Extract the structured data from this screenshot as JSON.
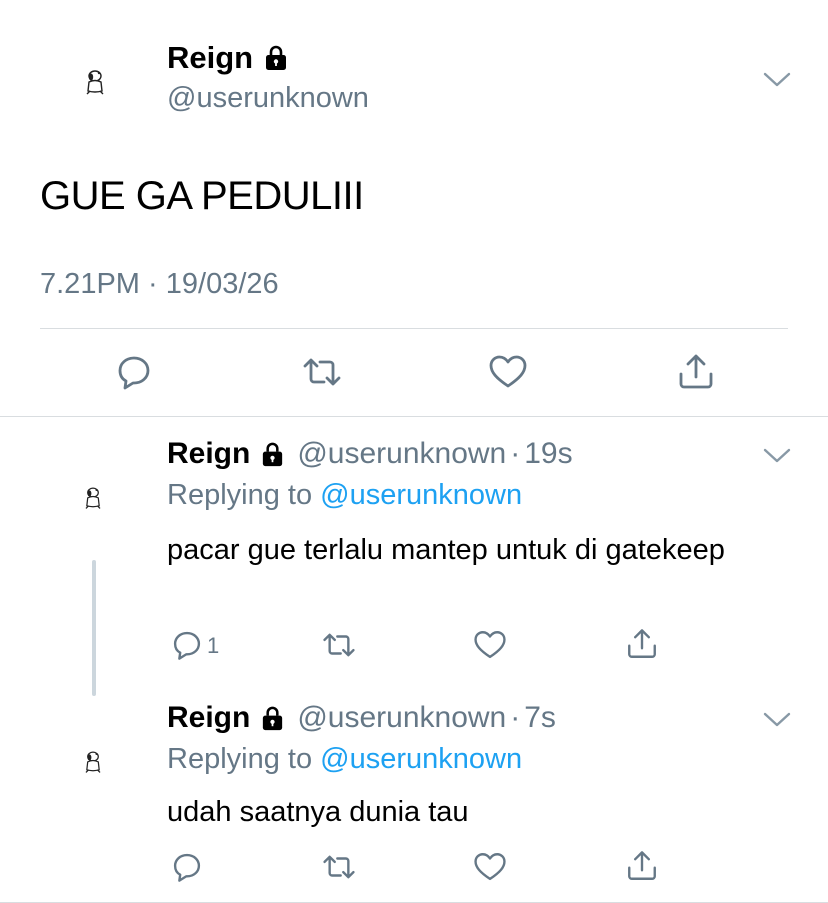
{
  "main_tweet": {
    "display_name": "Reign",
    "handle": "@userunknown",
    "text": "GUE GA PEDULIII",
    "time": "7.21PM",
    "separator": "·",
    "date": "19/03/26",
    "icons": {
      "avatar": "snoopy-avatar-icon",
      "lock": "lock-icon",
      "menu": "chevron-down-icon",
      "reply": "reply-icon",
      "retweet": "retweet-icon",
      "like": "heart-icon",
      "share": "share-icon"
    }
  },
  "replies": [
    {
      "display_name": "Reign",
      "handle": "@userunknown",
      "separator": "·",
      "time": "19s",
      "replying_label": "Replying to",
      "replying_to": "@userunknown",
      "text": "pacar gue terlalu mantep untuk di gatekeep",
      "reply_count": "1"
    },
    {
      "display_name": "Reign",
      "handle": "@userunknown",
      "separator": "·",
      "time": "7s",
      "replying_label": "Replying to",
      "replying_to": "@userunknown",
      "text": "udah saatnya dunia tau",
      "reply_count": ""
    }
  ],
  "colors": {
    "text_primary": "#000000",
    "text_secondary": "#657786",
    "link": "#1da1f2",
    "divider": "#d9dde0",
    "thread_line": "#ccd6dd"
  }
}
